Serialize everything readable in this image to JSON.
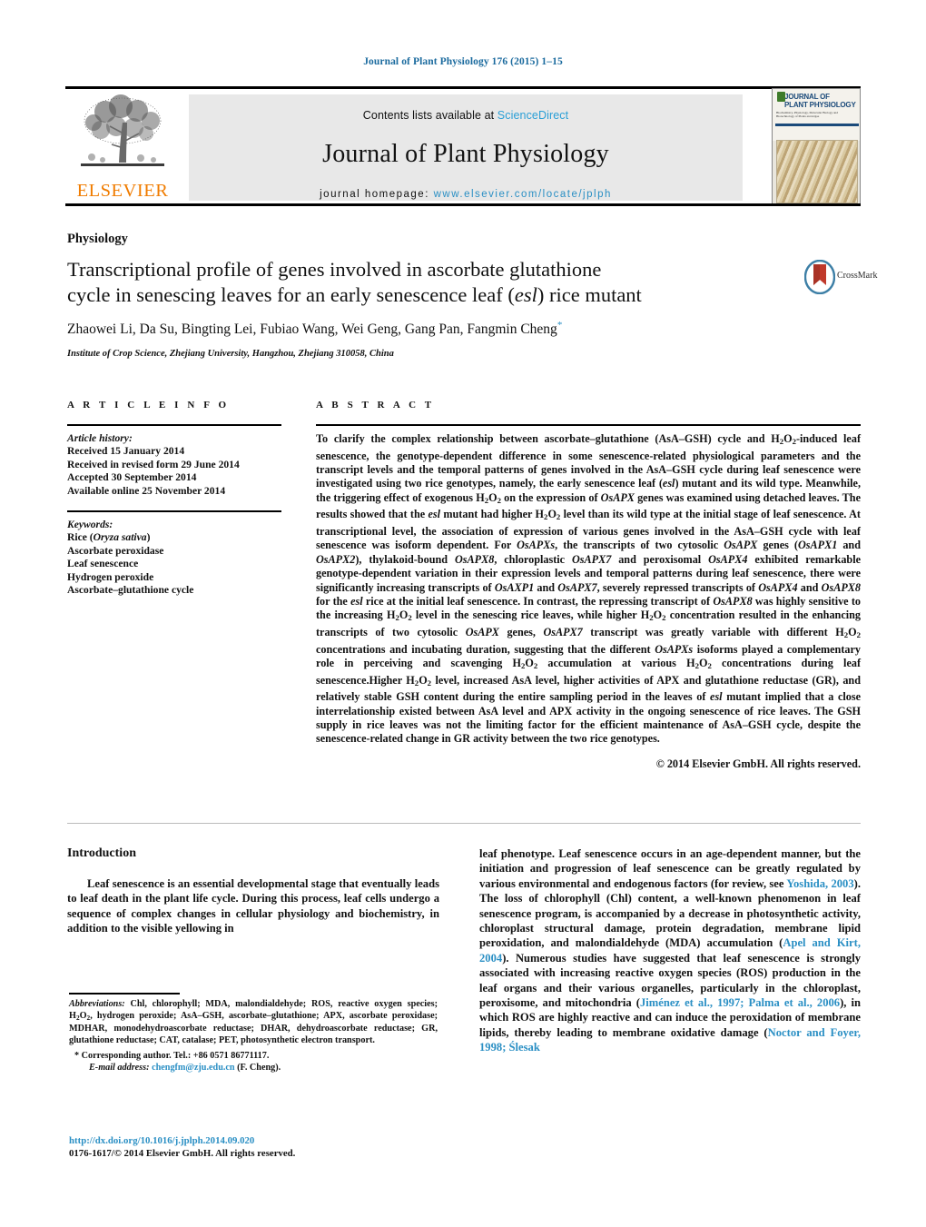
{
  "running_head": "Journal of Plant Physiology 176 (2015) 1–15",
  "masthead": {
    "publisher": "ELSEVIER",
    "contents_prefix": "Contents lists available at ",
    "contents_link": "ScienceDirect",
    "journal_title": "Journal of Plant Physiology",
    "homepage_label": "journal homepage:",
    "homepage_url": "www.elsevier.com/locate/jplph",
    "cover": {
      "line1": "JOURNAL OF",
      "line2": "PLANT PHYSIOLOGY",
      "subline": "Biochemistry, Physiology, Molecular Biology and Biotechnology of Plants and Algae"
    }
  },
  "article": {
    "section": "Physiology",
    "title_line1": "Transcriptional profile of genes involved in ascorbate glutathione",
    "title_line2_pre": "cycle in senescing leaves for an early senescence leaf (",
    "title_italic": "esl",
    "title_line2_post": ") rice mutant",
    "authors": "Zhaowei Li, Da Su, Bingting Lei, Fubiao Wang, Wei Geng, Gang Pan, Fangmin Cheng",
    "affiliation": "Institute of Crop Science, Zhejiang University, Hangzhou, Zhejiang 310058, China",
    "crossmark_label": "CrossMark"
  },
  "article_info": {
    "heading": "A R T I C L E   I N F O",
    "history_label": "Article history:",
    "history": [
      "Received 15 January 2014",
      "Received in revised form 29 June 2014",
      "Accepted 30 September 2014",
      "Available online 25 November 2014"
    ],
    "keywords_label": "Keywords:",
    "keywords_first_pre": "Rice (",
    "keywords_first_italic": "Oryza sativa",
    "keywords_first_post": ")",
    "keywords": [
      "Ascorbate peroxidase",
      "Leaf senescence",
      "Hydrogen peroxide",
      "Ascorbate–glutathione cycle"
    ]
  },
  "abstract": {
    "heading": "A B S T R A C T",
    "text_parts": [
      {
        "t": "To clarify the complex relationship between ascorbate–glutathione (AsA–GSH) cycle and H"
      },
      {
        "t": "2",
        "s": "sub"
      },
      {
        "t": "O"
      },
      {
        "t": "2",
        "s": "sub"
      },
      {
        "t": "-induced leaf senescence, the genotype-dependent difference in some senescence-related physiological parameters and the transcript levels and the temporal patterns of genes involved in the AsA–GSH cycle during leaf senescence were investigated using two rice genotypes, namely, the early senescence leaf ("
      },
      {
        "t": "esl",
        "s": "i"
      },
      {
        "t": ") mutant and its wild type. Meanwhile, the triggering effect of exogenous H"
      },
      {
        "t": "2",
        "s": "sub"
      },
      {
        "t": "O"
      },
      {
        "t": "2",
        "s": "sub"
      },
      {
        "t": " on the expression of "
      },
      {
        "t": "OsAPX",
        "s": "i"
      },
      {
        "t": " genes was examined using detached leaves. The results showed that the "
      },
      {
        "t": "esl",
        "s": "i"
      },
      {
        "t": " mutant had higher H"
      },
      {
        "t": "2",
        "s": "sub"
      },
      {
        "t": "O"
      },
      {
        "t": "2",
        "s": "sub"
      },
      {
        "t": " level than its wild type at the initial stage of leaf senescence. At transcriptional level, the association of expression of various genes involved in the AsA–GSH cycle with leaf senescence was isoform dependent. For "
      },
      {
        "t": "OsAPXs",
        "s": "i"
      },
      {
        "t": ", the transcripts of two cytosolic "
      },
      {
        "t": "OsAPX",
        "s": "i"
      },
      {
        "t": " genes ("
      },
      {
        "t": "OsAPX1",
        "s": "i"
      },
      {
        "t": " and "
      },
      {
        "t": "OsAPX2",
        "s": "i"
      },
      {
        "t": "), thylakoid-bound "
      },
      {
        "t": "OsAPX8",
        "s": "i"
      },
      {
        "t": ", chloroplastic "
      },
      {
        "t": "OsAPX7",
        "s": "i"
      },
      {
        "t": " and peroxisomal "
      },
      {
        "t": "OsAPX4",
        "s": "i"
      },
      {
        "t": " exhibited remarkable genotype-dependent variation in their expression levels and temporal patterns during leaf senescence, there were significantly increasing transcripts of "
      },
      {
        "t": "OsAXP1",
        "s": "i"
      },
      {
        "t": " and "
      },
      {
        "t": "OsAPX7",
        "s": "i"
      },
      {
        "t": ", severely repressed transcripts of "
      },
      {
        "t": "OsAPX4",
        "s": "i"
      },
      {
        "t": " and "
      },
      {
        "t": "OsAPX8",
        "s": "i"
      },
      {
        "t": " for the "
      },
      {
        "t": "esl",
        "s": "i"
      },
      {
        "t": " rice at the initial leaf senescence. In contrast, the repressing transcript of "
      },
      {
        "t": "OsAPX8",
        "s": "i"
      },
      {
        "t": " was highly sensitive to the increasing H"
      },
      {
        "t": "2",
        "s": "sub"
      },
      {
        "t": "O"
      },
      {
        "t": "2",
        "s": "sub"
      },
      {
        "t": " level in the senescing rice leaves, while higher H"
      },
      {
        "t": "2",
        "s": "sub"
      },
      {
        "t": "O"
      },
      {
        "t": "2",
        "s": "sub"
      },
      {
        "t": " concentration resulted in the enhancing transcripts of two cytosolic "
      },
      {
        "t": "OsAPX",
        "s": "i"
      },
      {
        "t": " genes, "
      },
      {
        "t": "OsAPX7",
        "s": "i"
      },
      {
        "t": " transcript was greatly variable with different H"
      },
      {
        "t": "2",
        "s": "sub"
      },
      {
        "t": "O"
      },
      {
        "t": "2",
        "s": "sub"
      },
      {
        "t": " concentrations and incubating duration, suggesting that the different "
      },
      {
        "t": "OsAPXs",
        "s": "i"
      },
      {
        "t": " isoforms played a complementary role in perceiving and scavenging H"
      },
      {
        "t": "2",
        "s": "sub"
      },
      {
        "t": "O"
      },
      {
        "t": "2",
        "s": "sub"
      },
      {
        "t": " accumulation at various H"
      },
      {
        "t": "2",
        "s": "sub"
      },
      {
        "t": "O"
      },
      {
        "t": "2",
        "s": "sub"
      },
      {
        "t": " concentrations during leaf senescence.Higher H"
      },
      {
        "t": "2",
        "s": "sub"
      },
      {
        "t": "O"
      },
      {
        "t": "2",
        "s": "sub"
      },
      {
        "t": " level, increased AsA level, higher activities of APX and glutathione reductase (GR), and relatively stable GSH content during the entire sampling period in the leaves of "
      },
      {
        "t": "esl",
        "s": "i"
      },
      {
        "t": " mutant implied that a close interrelationship existed between AsA level and APX activity in the ongoing senescence of rice leaves. The GSH supply in rice leaves was not the limiting factor for the efficient maintenance of AsA–GSH cycle, despite the senescence-related change in GR activity between the two rice genotypes."
      }
    ],
    "copyright": "© 2014 Elsevier GmbH. All rights reserved."
  },
  "body": {
    "intro_heading": "Introduction",
    "left_paragraph": "Leaf senescence is an essential developmental stage that eventually leads to leaf death in the plant life cycle. During this process, leaf cells undergo a sequence of complex changes in cellular physiology and biochemistry, in addition to the visible yellowing in",
    "right_parts": [
      {
        "t": "leaf phenotype. Leaf senescence occurs in an age-dependent manner, but the initiation and progression of leaf senescence can be greatly regulated by various environmental and endogenous factors (for review, see "
      },
      {
        "t": "Yoshida, 2003",
        "s": "ref"
      },
      {
        "t": "). The loss of chlorophyll (Chl) content, a well-known phenomenon in leaf senescence program, is accompanied by a decrease in photosynthetic activity, chloroplast structural damage, protein degradation, membrane lipid peroxidation, and malondialdehyde (MDA) accumulation ("
      },
      {
        "t": "Apel and Kirt, 2004",
        "s": "ref"
      },
      {
        "t": "). Numerous studies have suggested that leaf senescence is strongly associated with increasing reactive oxygen species (ROS) production in the leaf organs and their various organelles, particularly in the chloroplast, peroxisome, and mitochondria ("
      },
      {
        "t": "Jiménez et al., 1997; Palma et al., 2006",
        "s": "ref"
      },
      {
        "t": "), in which ROS are highly reactive and can induce the peroxidation of membrane lipids, thereby leading to membrane oxidative damage ("
      },
      {
        "t": "Noctor and Foyer, 1998; Ślesak",
        "s": "ref"
      }
    ]
  },
  "footnotes": {
    "abbrev_parts": [
      {
        "t": "Abbreviations:",
        "s": "i"
      },
      {
        "t": "  Chl, chlorophyll; MDA, malondialdehyde; ROS, reactive oxygen species; H"
      },
      {
        "t": "2",
        "s": "sub"
      },
      {
        "t": "O"
      },
      {
        "t": "2",
        "s": "sub"
      },
      {
        "t": ", hydrogen peroxide; AsA–GSH, ascorbate–glutathione; APX, ascorbate peroxidase; MDHAR, monodehydroascorbate reductase; DHAR, dehydroascorbate reductase; GR, glutathione reductase; CAT, catalase; PET, photosynthetic electron transport."
      }
    ],
    "corresponding": "* Corresponding author. Tel.: +86 0571 86771117.",
    "email_label": "E-mail address:",
    "email": "chengfm@zju.edu.cn",
    "email_suffix": " (F. Cheng).",
    "doi": "http://dx.doi.org/10.1016/j.jplph.2014.09.020",
    "issn_line": "0176-1617/© 2014 Elsevier GmbH. All rights reserved."
  }
}
